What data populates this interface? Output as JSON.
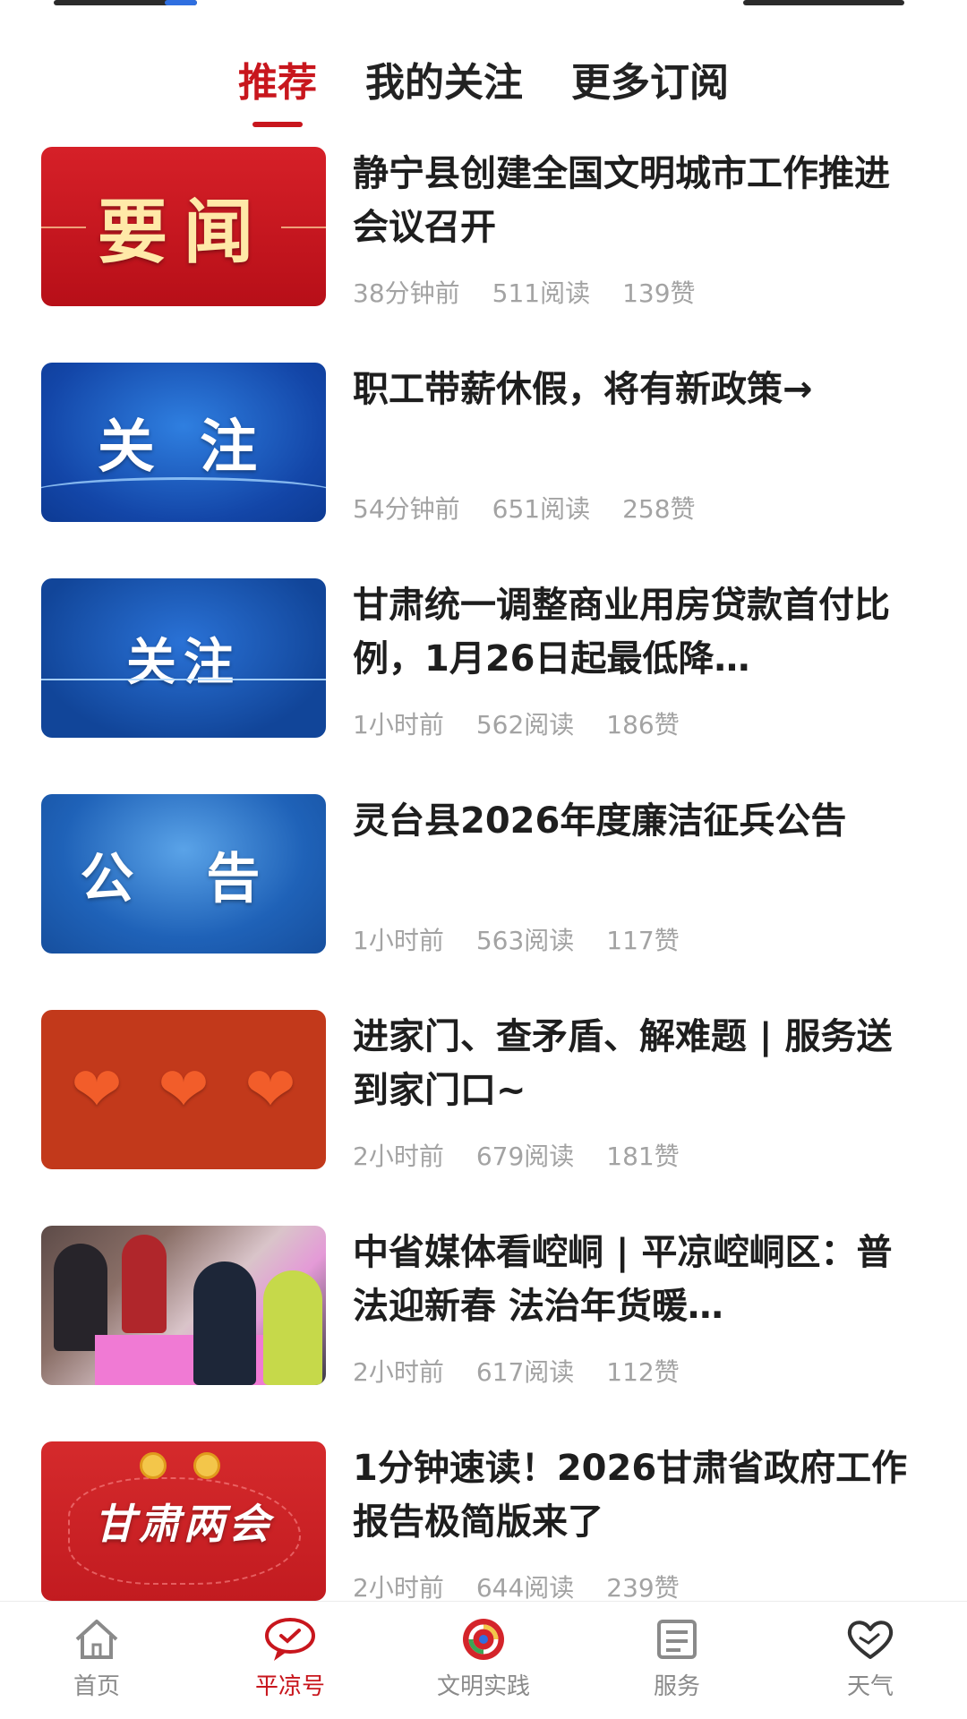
{
  "top_tabs": [
    {
      "label": "推荐",
      "active": true
    },
    {
      "label": "我的关注",
      "active": false
    },
    {
      "label": "更多订阅",
      "active": false
    }
  ],
  "news": [
    {
      "thumb_text": "要闻",
      "title": "静宁县创建全国文明城市工作推进会议召开",
      "time": "38分钟前",
      "reads": "511阅读",
      "likes": "139赞"
    },
    {
      "thumb_text": "关 注",
      "title": "职工带薪休假，将有新政策→",
      "time": "54分钟前",
      "reads": "651阅读",
      "likes": "258赞"
    },
    {
      "thumb_text": "关注",
      "title": "甘肃统一调整商业用房贷款首付比例，1月26日起最低降…",
      "time": "1小时前",
      "reads": "562阅读",
      "likes": "186赞"
    },
    {
      "thumb_text": "公 告",
      "title": "灵台县2026年度廉洁征兵公告",
      "time": "1小时前",
      "reads": "563阅读",
      "likes": "117赞"
    },
    {
      "thumb_text": "",
      "title": "进家门、查矛盾、解难题 | 服务送到家门口~",
      "time": "2小时前",
      "reads": "679阅读",
      "likes": "181赞"
    },
    {
      "thumb_text": "",
      "title": "中省媒体看崆峒 | 平凉崆峒区：普法迎新春 法治年货暖…",
      "time": "2小时前",
      "reads": "617阅读",
      "likes": "112赞"
    },
    {
      "thumb_text": "甘肃两会",
      "title": "1分钟速读！2026甘肃省政府工作报告极简版来了",
      "time": "2小时前",
      "reads": "644阅读",
      "likes": "239赞"
    }
  ],
  "bottom_nav": [
    {
      "label": "首页",
      "icon": "home-icon",
      "active": false
    },
    {
      "label": "平凉号",
      "icon": "chat-bubble-icon",
      "active": true
    },
    {
      "label": "文明实践",
      "icon": "swirl-logo-icon",
      "active": false
    },
    {
      "label": "服务",
      "icon": "service-list-icon",
      "active": false
    },
    {
      "label": "天气",
      "icon": "heart-hands-icon",
      "active": false
    }
  ],
  "colors": {
    "accent": "#c8161d",
    "meta_text": "#a3a3a3",
    "nav_inactive": "#8a8a8a"
  }
}
